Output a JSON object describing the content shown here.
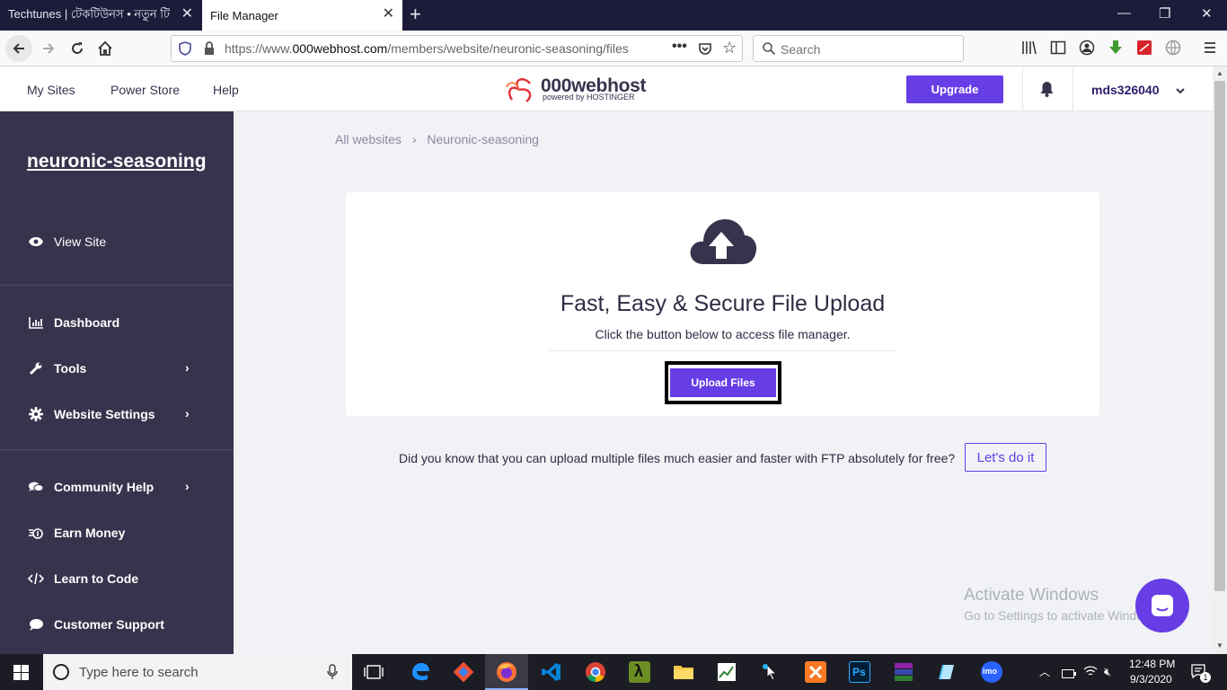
{
  "browser": {
    "tabs": [
      {
        "title": "Techtunes | টেকটিউনস • নতুন টিউ"
      },
      {
        "title": "File Manager"
      }
    ],
    "url_prefix": "https://www.",
    "url_domain": "000webhost.com",
    "url_path": "/members/website/neuronic-seasoning/files",
    "search_placeholder": "Search"
  },
  "header": {
    "nav": [
      "My Sites",
      "Power Store",
      "Help"
    ],
    "logo_text": "000webhost",
    "logo_sub": "powered by HOSTINGER",
    "upgrade_label": "Upgrade",
    "username": "mds326040"
  },
  "sidebar": {
    "site_name": "neuronic-seasoning",
    "view_site": "View Site",
    "items": [
      {
        "label": "Dashboard",
        "icon": "chart-icon"
      },
      {
        "label": "Tools",
        "icon": "wrench-icon"
      },
      {
        "label": "Website Settings",
        "icon": "gear-icon"
      },
      {
        "label": "Community Help",
        "icon": "chat-icon"
      },
      {
        "label": "Earn Money",
        "icon": "money-icon"
      },
      {
        "label": "Learn to Code",
        "icon": "code-icon"
      },
      {
        "label": "Customer Support",
        "icon": "support-icon"
      }
    ]
  },
  "main": {
    "breadcrumb": [
      "All websites",
      "Neuronic-seasoning"
    ],
    "card_title": "Fast, Easy & Secure File Upload",
    "card_subtitle": "Click the button below to access file manager.",
    "upload_label": "Upload Files",
    "ftp_text": "Did you know that you can upload multiple files much easier and faster with FTP absolutely for free?",
    "ftp_button": "Let's do it"
  },
  "watermark": {
    "line1": "Activate Windows",
    "line2": "Go to Settings to activate Windows."
  },
  "taskbar": {
    "search_placeholder": "Type here to search",
    "time": "12:48 PM",
    "date": "9/3/2020",
    "notification_count": "1"
  },
  "colors": {
    "accent": "#673de6",
    "sidebar_bg": "#36344d",
    "browser_dark": "#1c1b3a"
  }
}
